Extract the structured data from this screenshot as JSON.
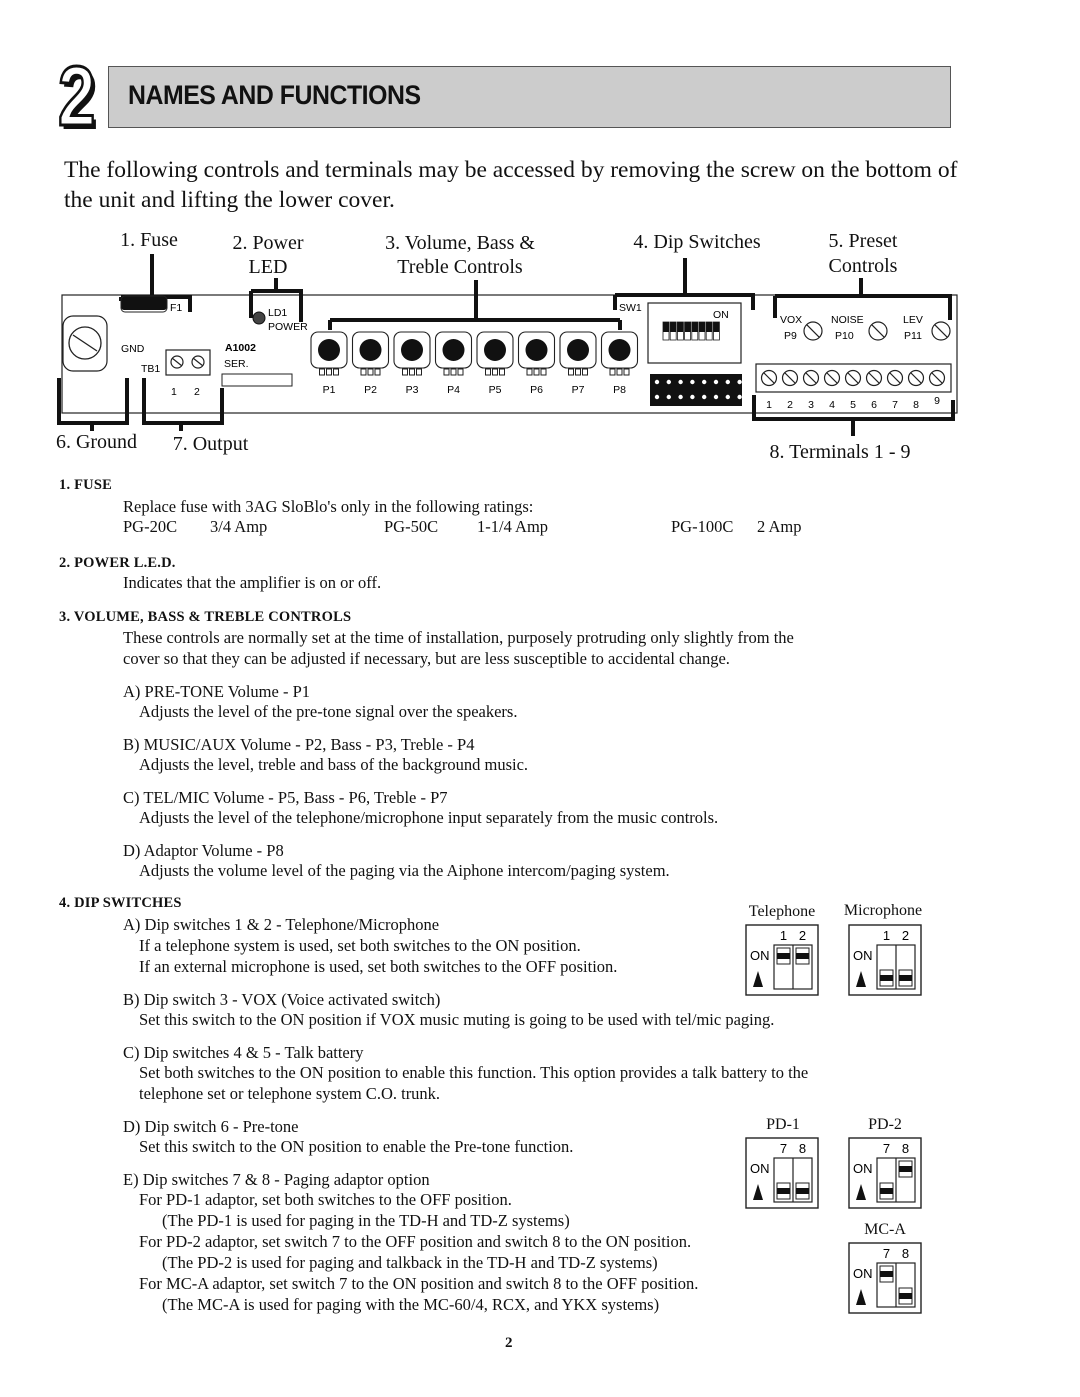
{
  "header": {
    "section_number": "2",
    "title": "NAMES AND FUNCTIONS"
  },
  "intro": "The following controls and terminals may be accessed by removing the screw on the bottom of the unit and lifting the lower cover.",
  "diagram": {
    "callouts": {
      "fuse": "1. Fuse",
      "power_led_1": "2. Power",
      "power_led_2": "LED",
      "controls_1": "3. Volume, Bass &",
      "controls_2": "Treble Controls",
      "dip": "4. Dip Switches",
      "preset_1": "5. Preset",
      "preset_2": "Controls",
      "ground": "6. Ground",
      "output": "7. Output",
      "terminals": "8. Terminals 1 - 9"
    },
    "board_labels": {
      "f1": "F1",
      "ld1": "LD1",
      "power": "POWER",
      "gnd": "GND",
      "tb1": "TB1",
      "tb1_pins": [
        "1",
        "2"
      ],
      "model": "A1002",
      "ser": "SER.",
      "sw1": "SW1",
      "on": "ON",
      "pots": [
        "P1",
        "P2",
        "P3",
        "P4",
        "P5",
        "P6",
        "P7",
        "P8"
      ],
      "presets": [
        {
          "name": "VOX",
          "id": "P9"
        },
        {
          "name": "NOISE",
          "id": "P10"
        },
        {
          "name": "LEV",
          "id": "P11"
        }
      ],
      "terminals": [
        "1",
        "2",
        "3",
        "4",
        "5",
        "6",
        "7",
        "8",
        "9"
      ]
    }
  },
  "sections": {
    "fuse": {
      "heading": "1. FUSE",
      "text": "Replace fuse with 3AG SloBlo's only in the following ratings:",
      "ratings": [
        {
          "model": "PG-20C",
          "rating": "3/4 Amp"
        },
        {
          "model": "PG-50C",
          "rating": "1-1/4 Amp"
        },
        {
          "model": "PG-100C",
          "rating": "2 Amp"
        }
      ]
    },
    "power_led": {
      "heading": "2. POWER L.E.D.",
      "text": "Indicates that the amplifier is on or off."
    },
    "controls": {
      "heading": "3. VOLUME, BASS & TREBLE CONTROLS",
      "text_1": "These controls are normally set at the time of installation, purposely protruding only slightly from the",
      "text_2": "cover so that they can be adjusted if necessary, but are less susceptible to accidental change.",
      "items": [
        {
          "title": "A) PRE-TONE Volume - P1",
          "desc": "Adjusts the level of the pre-tone signal over the speakers."
        },
        {
          "title": "B) MUSIC/AUX Volume - P2, Bass - P3, Treble - P4",
          "desc": "Adjusts the level, treble and bass of the background music."
        },
        {
          "title": "C) TEL/MIC Volume - P5, Bass - P6, Treble - P7",
          "desc": "Adjusts the level of the telephone/microphone input separately from the music controls."
        },
        {
          "title": "D) Adaptor Volume - P8",
          "desc": "Adjusts the volume level of the paging via the Aiphone intercom/paging system."
        }
      ]
    },
    "dip": {
      "heading": "4. DIP SWITCHES",
      "a_title": "A) Dip switches 1 & 2 - Telephone/Microphone",
      "a_line1": "If a telephone system is used, set both switches to the ON position.",
      "a_line2": "If an external microphone is used, set both switches to the OFF position.",
      "b_title": "B) Dip switch 3 - VOX (Voice activated switch)",
      "b_desc": "Set this switch to the ON position if VOX  music muting is going to be used with tel/mic paging.",
      "c_title": "C) Dip switches 4 & 5 - Talk battery",
      "c_line1": "Set both switches to the ON position to enable this function.  This option provides a talk battery to the",
      "c_line2": "telephone set or telephone system C.O. trunk.",
      "d_title": "D) Dip switch 6 - Pre-tone",
      "d_desc": "Set this switch to the ON position to enable the Pre-tone function.",
      "e_title": "E) Dip switches 7 & 8 - Paging adaptor option",
      "e_lines": [
        "For PD-1 adaptor, set both switches to the OFF position.",
        "(The PD-1 is used for paging in the TD-H and TD-Z systems)",
        "For PD-2 adaptor, set switch 7 to the OFF position and switch 8 to the ON position.",
        "(The PD-2 is used for paging and talkback in the TD-H and TD-Z systems)",
        "For MC-A adaptor, set switch 7 to the ON position and switch 8 to the OFF position.",
        "(The MC-A is used for paging with the MC-60/4, RCX, and YKX systems)"
      ],
      "diagrams": {
        "on_label": "ON",
        "telephone": {
          "title": "Telephone",
          "switches": [
            "1",
            "2"
          ],
          "states": [
            "on",
            "on"
          ]
        },
        "microphone": {
          "title": "Microphone",
          "switches": [
            "1",
            "2"
          ],
          "states": [
            "off",
            "off"
          ]
        },
        "pd1": {
          "title": "PD-1",
          "switches": [
            "7",
            "8"
          ],
          "states": [
            "off",
            "off"
          ]
        },
        "pd2": {
          "title": "PD-2",
          "switches": [
            "7",
            "8"
          ],
          "states": [
            "off",
            "on"
          ]
        },
        "mca": {
          "title": "MC-A",
          "switches": [
            "7",
            "8"
          ],
          "states": [
            "on",
            "off"
          ]
        }
      }
    }
  },
  "page_number": "2"
}
